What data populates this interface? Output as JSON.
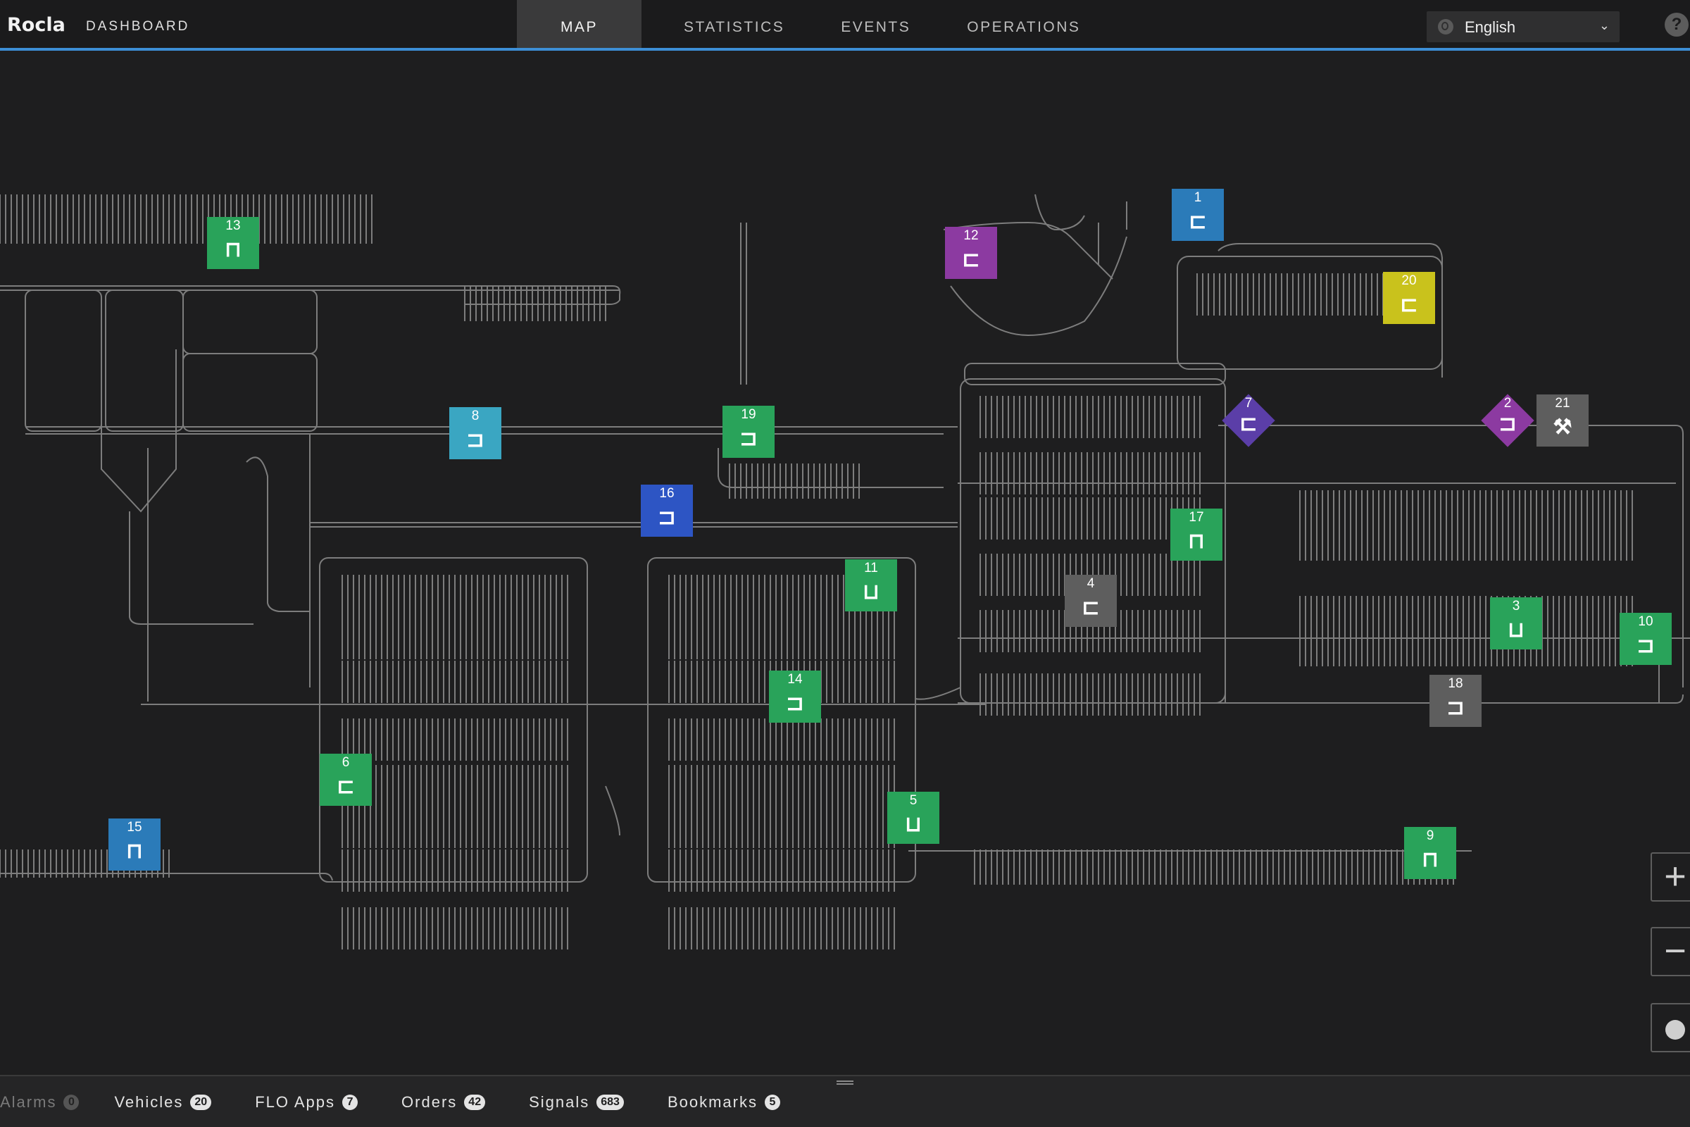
{
  "header": {
    "brand": "Rocla",
    "subtitle": "DASHBOARD",
    "tabs": [
      {
        "label": "MAP",
        "active": true
      },
      {
        "label": "STATISTICS",
        "active": false
      },
      {
        "label": "EVENTS",
        "active": false
      },
      {
        "label": "OPERATIONS",
        "active": false
      }
    ],
    "language": {
      "value": "English"
    },
    "help_label": "?"
  },
  "colors": {
    "accent": "#3d8fd6",
    "green": "#29a35a",
    "purple": "#8c3aa1",
    "violet": "#5b3ea8",
    "blue": "#2b7bb9",
    "cyan": "#3aa6c2",
    "royal": "#2d55c4",
    "yellow": "#c9c21c",
    "gray": "#5e5e5e"
  },
  "vehicles": [
    {
      "id": "1",
      "glyph": "⊏",
      "color": "blue"
    },
    {
      "id": "2",
      "glyph": "⊐",
      "color": "purple",
      "shape": "diamond"
    },
    {
      "id": "3",
      "glyph": "⊔",
      "color": "green"
    },
    {
      "id": "4",
      "glyph": "⊏",
      "color": "gray"
    },
    {
      "id": "5",
      "glyph": "⊔",
      "color": "green"
    },
    {
      "id": "6",
      "glyph": "⊏",
      "color": "green"
    },
    {
      "id": "7",
      "glyph": "⊏",
      "color": "violet",
      "shape": "diamond"
    },
    {
      "id": "8",
      "glyph": "⊐",
      "color": "cyan"
    },
    {
      "id": "9",
      "glyph": "⊓",
      "color": "green"
    },
    {
      "id": "10",
      "glyph": "⊐",
      "color": "green"
    },
    {
      "id": "11",
      "glyph": "⊔",
      "color": "green"
    },
    {
      "id": "12",
      "glyph": "⊏",
      "color": "purple"
    },
    {
      "id": "13",
      "glyph": "⊓",
      "color": "green"
    },
    {
      "id": "14",
      "glyph": "⊐",
      "color": "green"
    },
    {
      "id": "15",
      "glyph": "⊓",
      "color": "blue"
    },
    {
      "id": "16",
      "glyph": "⊐",
      "color": "royal"
    },
    {
      "id": "17",
      "glyph": "⊓",
      "color": "green"
    },
    {
      "id": "18",
      "glyph": "⊐",
      "color": "gray"
    },
    {
      "id": "19",
      "glyph": "⊐",
      "color": "green"
    },
    {
      "id": "20",
      "glyph": "⊏",
      "color": "yellow"
    },
    {
      "id": "21",
      "glyph": "⚒",
      "color": "gray"
    }
  ],
  "zoom": {
    "in": "+",
    "out": "−"
  },
  "bottom_tabs": [
    {
      "label": "Alarms",
      "count": "0",
      "dim": true
    },
    {
      "label": "Vehicles",
      "count": "20"
    },
    {
      "label": "FLO Apps",
      "count": "7"
    },
    {
      "label": "Orders",
      "count": "42"
    },
    {
      "label": "Signals",
      "count": "683"
    },
    {
      "label": "Bookmarks",
      "count": "5"
    }
  ]
}
